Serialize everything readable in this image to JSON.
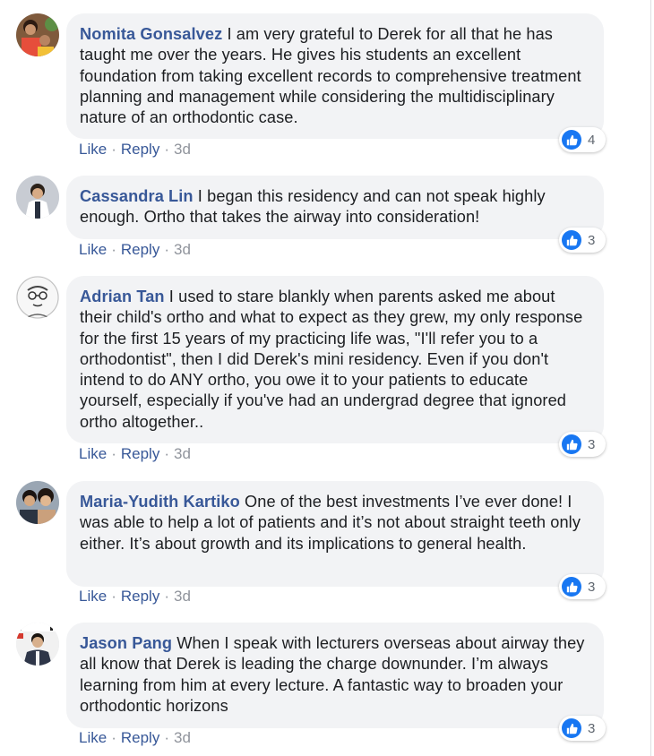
{
  "comments": [
    {
      "author": "Nomita Gonsalvez",
      "text": "I am very grateful to Derek for all that he has taught me over the years. He gives his students an excellent foundation from taking excellent records to comprehensive treatment planning and management while considering the multidisciplinary nature of an orthodontic case.",
      "like_label": "Like",
      "reply_label": "Reply",
      "time": "3d",
      "reactions": "4"
    },
    {
      "author": "Cassandra Lin",
      "text": "I began this residency and can not speak highly enough. Ortho that takes the airway into consideration!",
      "like_label": "Like",
      "reply_label": "Reply",
      "time": "3d",
      "reactions": "3"
    },
    {
      "author": "Adrian Tan",
      "text": "I used to stare blankly when parents asked me about their child's ortho and what to expect as they grew, my only response for the first 15 years of my practicing life was, \"I'll refer you to a orthodontist\", then I did Derek's mini residency. Even if you don't intend to do ANY ortho, you owe it to your patients to educate yourself, especially if you've had an undergrad degree that ignored ortho altogether..",
      "like_label": "Like",
      "reply_label": "Reply",
      "time": "3d",
      "reactions": "3"
    },
    {
      "author": "Maria-Yudith Kartiko",
      "text": "One of the best investments I’ve ever done! I was able to help a lot of patients and it’s not about straight teeth only either. It’s about growth and its implications to general health.",
      "like_label": "Like",
      "reply_label": "Reply",
      "time": "3d",
      "reactions": "3"
    },
    {
      "author": "Jason Pang",
      "text": "When I speak with lecturers overseas about airway they all know that Derek is leading the charge downunder. I’m always learning from him at every lecture. A fantastic way to broaden your orthodontic horizons",
      "like_label": "Like",
      "reply_label": "Reply",
      "time": "3d",
      "reactions": "3"
    }
  ],
  "icons": {
    "reaction": "thumbs-up-icon"
  },
  "colors": {
    "author": "#385898",
    "bubble": "#f2f3f5",
    "like_badge": "#1877f2",
    "meta": "#90949c"
  }
}
